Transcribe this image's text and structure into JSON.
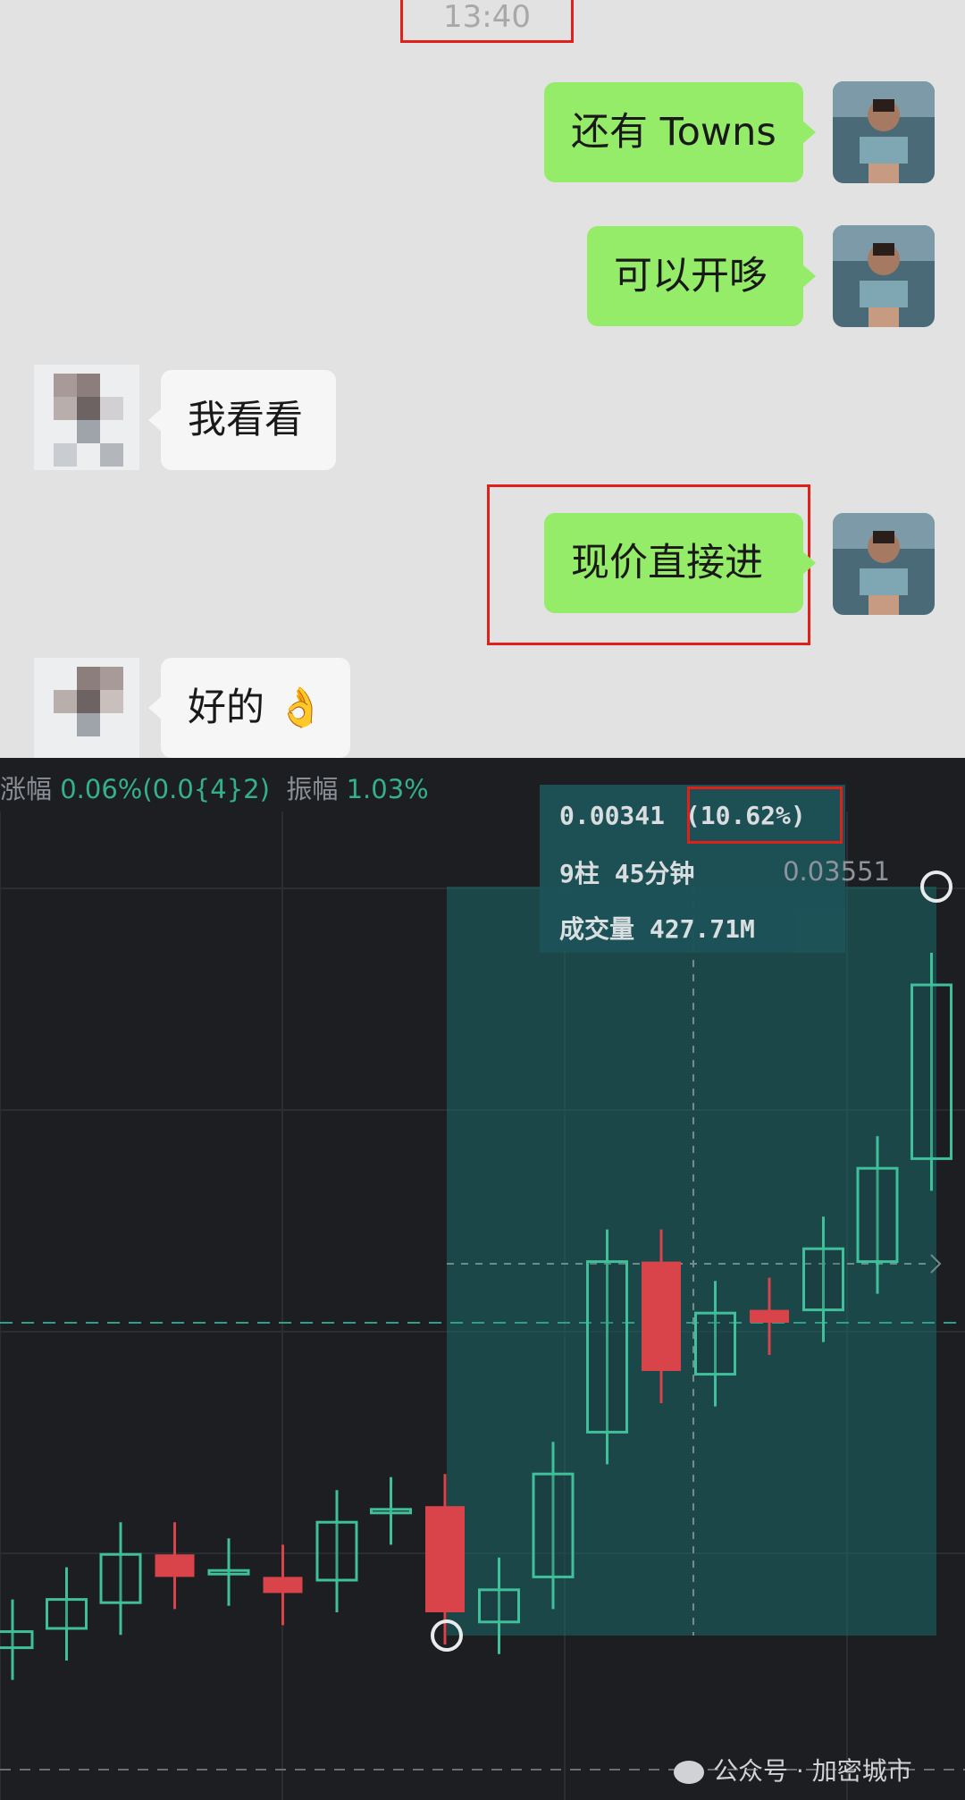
{
  "chat": {
    "timestamp": "13:40",
    "messages": [
      {
        "side": "me",
        "text": "还有 Towns"
      },
      {
        "side": "me",
        "text": "可以开哆"
      },
      {
        "side": "other",
        "text": "我看看"
      },
      {
        "side": "me",
        "text": "现价直接进"
      },
      {
        "side": "other",
        "text": "好的 👌"
      }
    ]
  },
  "chart": {
    "stats": {
      "change_label": "涨幅",
      "change_value": "0.06%(0.0{4}2)",
      "amplitude_label": "振幅",
      "amplitude_value": "1.03%"
    },
    "tooltip": {
      "price_change": "0.00341",
      "percent": "(10.62%)",
      "bars": "9柱 45分钟",
      "volume": "成交量 427.71M"
    },
    "price_marker": "0.03551",
    "colors": {
      "up": "#3fbf9a",
      "down": "#d9434a",
      "measure_fill": "#1c6a6a"
    }
  },
  "watermark": "公众号 · 加密城市",
  "chart_data": {
    "type": "candlestick",
    "candles": [
      {
        "dir": "up",
        "open": 0.4,
        "close": 0.9
      },
      {
        "dir": "up",
        "open": 1.0,
        "close": 1.9
      },
      {
        "dir": "up",
        "open": 1.8,
        "close": 3.3
      },
      {
        "dir": "down",
        "open": 3.3,
        "close": 2.6
      },
      {
        "dir": "up",
        "open": 2.7,
        "close": 2.8
      },
      {
        "dir": "down",
        "open": 2.6,
        "close": 2.1
      },
      {
        "dir": "up",
        "open": 2.5,
        "close": 4.3
      },
      {
        "dir": "up",
        "open": 4.6,
        "close": 4.7
      },
      {
        "dir": "down",
        "open": 4.8,
        "close": 1.5
      },
      {
        "dir": "up",
        "open": 1.2,
        "close": 2.2
      },
      {
        "dir": "up",
        "open": 2.6,
        "close": 5.8
      },
      {
        "dir": "up",
        "open": 7.1,
        "close": 12.4
      },
      {
        "dir": "down",
        "open": 12.4,
        "close": 9.0
      },
      {
        "dir": "up",
        "open": 8.9,
        "close": 10.8
      },
      {
        "dir": "down",
        "open": 10.9,
        "close": 10.5
      },
      {
        "dir": "up",
        "open": 10.9,
        "close": 12.8
      },
      {
        "dir": "up",
        "open": 12.4,
        "close": 15.3
      },
      {
        "dir": "up",
        "open": 15.6,
        "close": 21.0
      }
    ]
  }
}
